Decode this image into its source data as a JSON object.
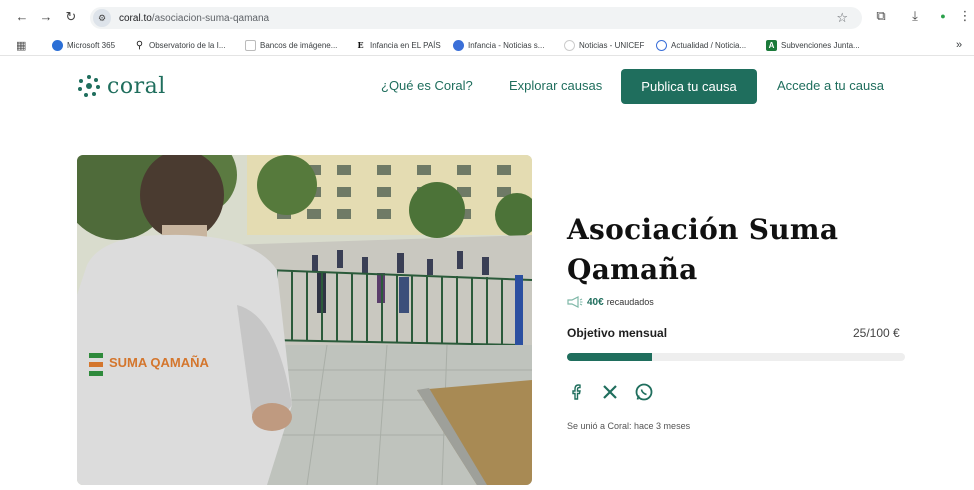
{
  "browser": {
    "url_domain": "coral.to",
    "url_path": "/asociacion-suma-qamana",
    "bookmarks": [
      {
        "label": "Microsoft 365",
        "icon": "microsoft-365-icon"
      },
      {
        "label": "Observatorio de la I...",
        "icon": "pin-icon"
      },
      {
        "label": "Bancos de imágene...",
        "icon": "image-bank-icon"
      },
      {
        "label": "Infancia en EL PAÍS",
        "icon": "el-pais-icon"
      },
      {
        "label": "Infancia - Noticias s...",
        "icon": "globe-icon"
      },
      {
        "label": "Noticias - UNICEF",
        "icon": "unicef-icon"
      },
      {
        "label": "Actualidad / Noticia...",
        "icon": "news-icon"
      },
      {
        "label": "Subvenciones Junta...",
        "icon": "junta-icon"
      }
    ],
    "more_label": "»"
  },
  "site": {
    "brand": "coral",
    "nav": [
      "¿Qué es Coral?",
      "Explorar causas"
    ],
    "cta": "Publica tu causa",
    "login": "Accede a tu causa",
    "brand_color": "#1f6e5d"
  },
  "cause": {
    "title": "Asociación Suma Qamaña",
    "raised_amount": "40€",
    "raised_label": "recaudados",
    "goal_label": "Objetivo mensual",
    "goal_value": "25/100 €",
    "progress_fraction": 0.25,
    "joined": "Se unió a Coral: hace 3 meses",
    "share_icons": [
      "facebook-icon",
      "x-icon",
      "whatsapp-icon"
    ]
  },
  "hero_image": {
    "vest_text": "SUMA QAMAÑA"
  }
}
